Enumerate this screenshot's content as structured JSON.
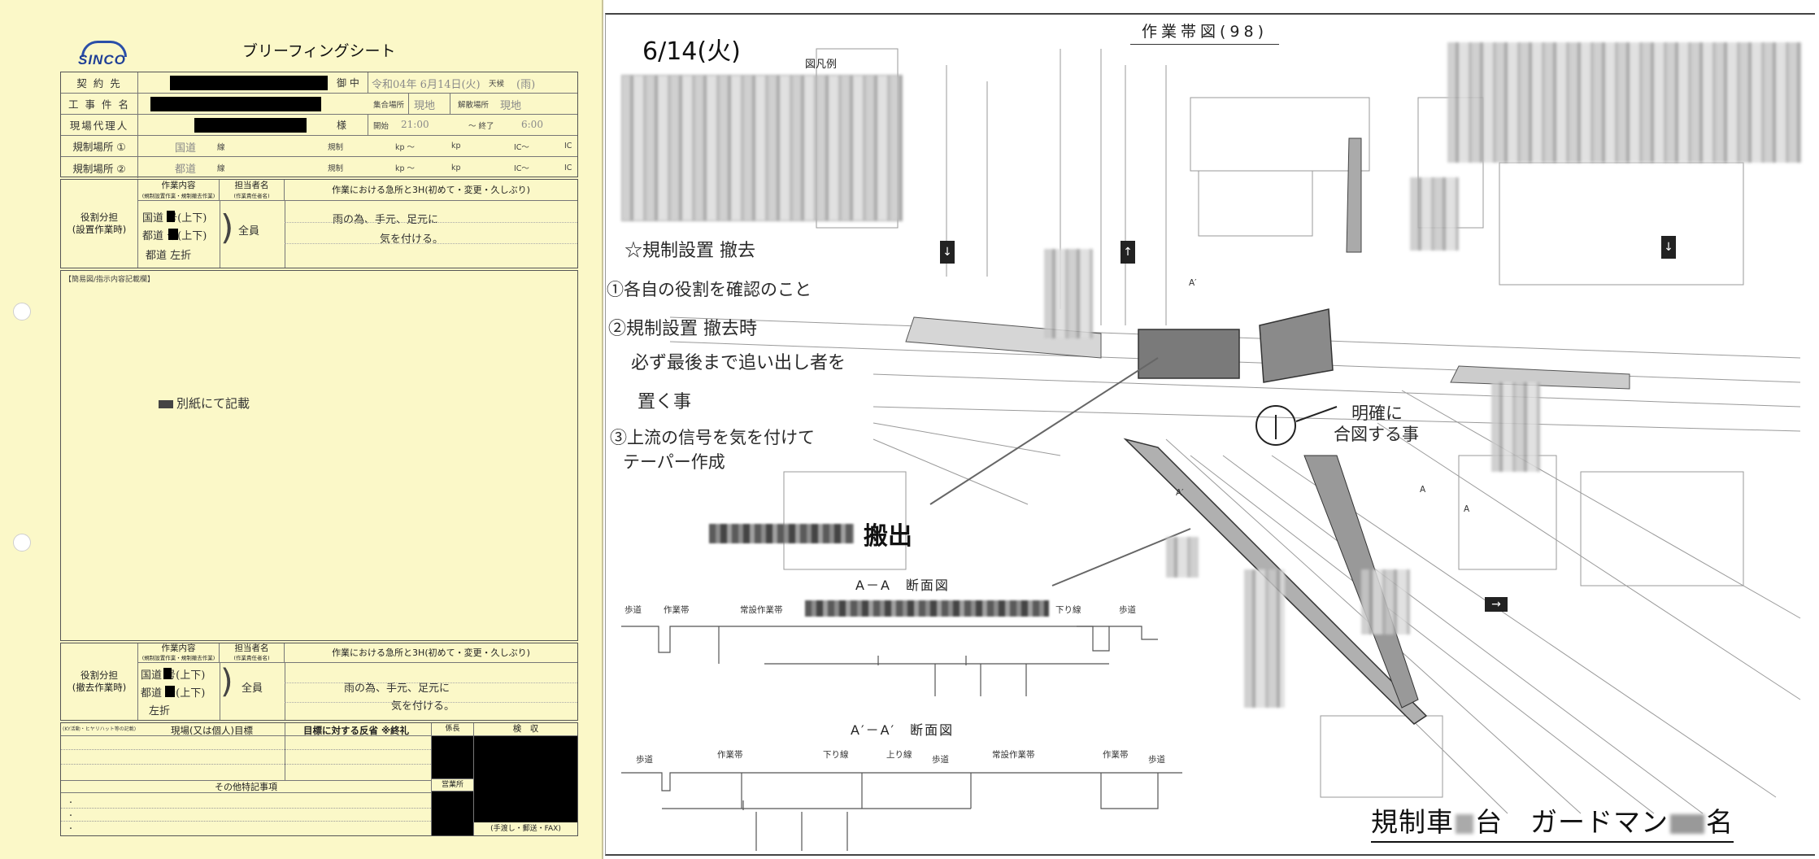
{
  "left_sheet": {
    "logo_text": "SINCO",
    "title": "ブリーフィングシート",
    "contract_label": "契 約 先",
    "contract_suffix": "御 中",
    "date_value": "令和04年 6月14日(火)",
    "weather_label": "天候",
    "weather_value": "(雨)",
    "project_label": "工 事 件 名",
    "meeting_place_label": "集合場所",
    "meeting_place_value": "現地",
    "dismiss_place_label": "解散場所",
    "dismiss_place_value": "現地",
    "site_agent_label": "現場代理人",
    "site_agent_suffix": "様",
    "start_label": "開始",
    "start_value": "21:00",
    "end_label": "〜 終了",
    "end_value": "6:00",
    "reg_place1_label": "規制場所 ①",
    "reg_place1_road": "国道",
    "reg_place2_label": "規制場所 ②",
    "reg_place2_road": "都道",
    "line_suffix": "線",
    "reg_label": "規制",
    "kp_from": "kp 〜",
    "kp_to": "kp",
    "ic_from": "IC〜",
    "ic_to": "IC",
    "task_header": "作業内容",
    "task_subheader": "(規制設置作業・規制撤去作業)",
    "assignee_header": "担当者名",
    "assignee_subheader": "(作業責任者名)",
    "caution_header": "作業における急所と3H(初めて・変更・久しぶり)",
    "install_role_label": "役割分担\n(設置作業時)",
    "install_tasks": [
      "国道 号(上下)",
      "都道 号(上下)",
      "都道 左折"
    ],
    "install_assignee": "全員",
    "install_caution_1": "雨の為、手元、足元に",
    "install_caution_2": "気を付ける。",
    "sketch_label": "【簡易図/指示内容記載欄】",
    "sketch_note": "別紙にて記載",
    "removal_role_label": "役割分担\n(撤去作業時)",
    "removal_tasks": [
      "国道 号(上下)",
      "都道 号(上下)",
      "左折"
    ],
    "removal_assignee": "全員",
    "removal_caution_1": "雨の為、手元、足元に",
    "removal_caution_2": "気を付ける。",
    "target_label": "現場(又は個人)目標",
    "review_label": "目標に対する反省 ※終礼",
    "section_head_label": "係長",
    "inspection_label": "検　収",
    "other_notes_label": "その他特記事項",
    "sales_label": "営業所",
    "delivery_label": "(手渡し・郵送・FAX)",
    "small_header_note": "(KY活動・ヒヤリハット等の記載)"
  },
  "right_sheet": {
    "map_title": "作業帯図(98)",
    "date": "6/14(火)",
    "legend_title": "図凡例",
    "notes": [
      "☆規制設置 撤去",
      "①各自の役割を確認のこと",
      "②規制設置 撤去時",
      "必ず最後まで追い出し者を",
      "置く事",
      "③上流の信号を気を付けて",
      "テーパー作成"
    ],
    "signal_note_1": "明確に",
    "signal_note_2": "合図する事",
    "carry_out_suffix": "搬出",
    "section_aa_title": "A－A　断面図",
    "section_aa2_title": "A′－A′　断面図",
    "section_labels_aa": [
      "歩道",
      "作業帯",
      "常設作業帯",
      "下り線",
      "歩道"
    ],
    "section_labels_aa2": [
      "歩道",
      "作業帯",
      "下り線",
      "上り線",
      "歩道",
      "常設作業帯",
      "作業帯",
      "歩道"
    ],
    "map_marks": [
      "A",
      "A′",
      "A",
      "A′"
    ],
    "bottom_caption_prefix": "規制車",
    "bottom_caption_mid": "台　ガードマン",
    "bottom_caption_suffix": "名"
  }
}
